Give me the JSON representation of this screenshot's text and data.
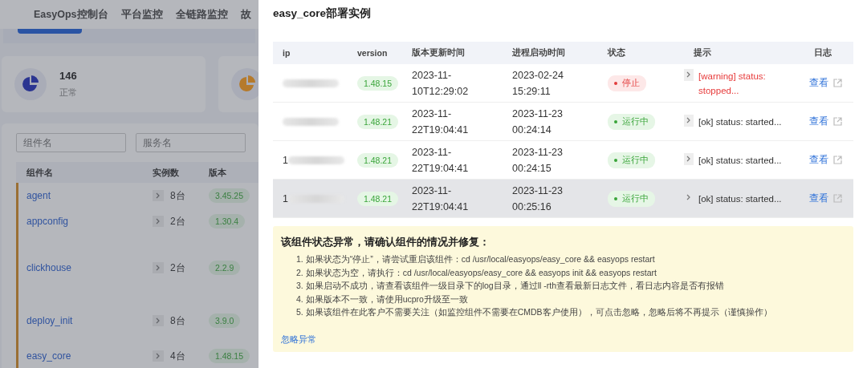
{
  "background": {
    "nav": {
      "items": [
        "EasyOps控制台",
        "平台监控",
        "全链路监控",
        "故"
      ]
    },
    "stats": [
      {
        "value": "146",
        "label": "正常",
        "color": "#2b3591"
      },
      {
        "color": "#b57a2c"
      }
    ],
    "filters": [
      {
        "placeholder": "组件名"
      },
      {
        "placeholder": "服务名"
      }
    ],
    "table": {
      "columns": [
        "组件名",
        "实例数",
        "版本"
      ],
      "rows": [
        {
          "name": "agent",
          "count": "8台",
          "version": "3.45.25"
        },
        {
          "name": "appconfig",
          "count": "2台",
          "version": "1.30.4"
        },
        {
          "name": "clickhouse",
          "count": "2台",
          "version": "2.2.9"
        },
        {
          "name": "deploy_init",
          "count": "8台",
          "version": "3.9.0"
        },
        {
          "name": "easy_core",
          "count": "4台",
          "version": "1.48.15"
        }
      ]
    }
  },
  "drawer": {
    "title": "easy_core部署实例",
    "columns": [
      "ip",
      "version",
      "版本更新时间",
      "进程启动时间",
      "状态",
      "提示",
      "日志"
    ],
    "rows": [
      {
        "ip": "",
        "version": "1.48.15",
        "updated": "2023-11-10T12:29:02",
        "started": "2023-02-24 15:29:11",
        "status": {
          "label": "停止",
          "kind": "stopped"
        },
        "hint": {
          "text": "[warning] status: stopped...",
          "kind": "warning"
        },
        "log": "查看",
        "selected": false
      },
      {
        "ip": "",
        "version": "1.48.21",
        "updated": "2023-11-22T19:04:41",
        "started": "2023-11-23 00:24:14",
        "status": {
          "label": "运行中",
          "kind": "running"
        },
        "hint": {
          "text": "[ok] status: started...",
          "kind": "ok"
        },
        "log": "查看",
        "selected": false
      },
      {
        "ip": "1",
        "version": "1.48.21",
        "updated": "2023-11-22T19:04:41",
        "started": "2023-11-23 00:24:15",
        "status": {
          "label": "运行中",
          "kind": "running"
        },
        "hint": {
          "text": "[ok] status: started...",
          "kind": "ok"
        },
        "log": "查看",
        "selected": false
      },
      {
        "ip": "1",
        "version": "1.48.21",
        "updated": "2023-11-22T19:04:41",
        "started": "2023-11-23 00:25:16",
        "status": {
          "label": "运行中",
          "kind": "running"
        },
        "hint": {
          "text": "[ok] status: started...",
          "kind": "ok"
        },
        "log": "查看",
        "selected": true
      }
    ],
    "notice": {
      "title": "该组件状态异常，请确认组件的情况并修复：",
      "items": [
        "1. 如果状态为“停止”，请尝试重启该组件：cd /usr/local/easyops/easy_core && easyops restart",
        "2. 如果状态为空，请执行：cd /usr/local/easyops/easy_core && easyops init && easyops restart",
        "3. 如果启动不成功，请查看该组件一级目录下的log目录，通过ll -rth查看最新日志文件，看日志内容是否有报错",
        "4. 如果版本不一致，请使用ucpro升级至一致",
        "5. 如果该组件在此客户不需要关注（如监控组件不需要在CMDB客户使用），可点击忽略，忽略后将不再提示（谨慎操作）"
      ],
      "link": "忽略异常"
    }
  }
}
